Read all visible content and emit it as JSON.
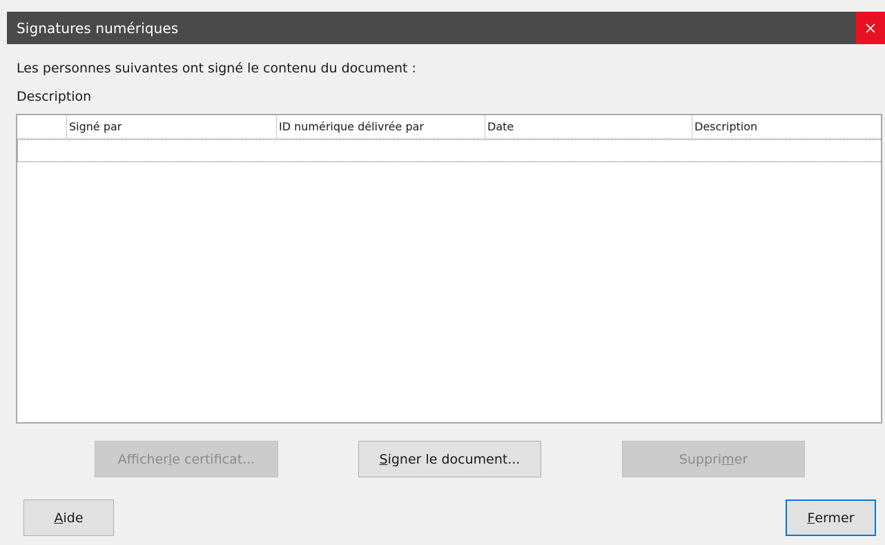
{
  "window": {
    "title": "Signatures numériques",
    "close_icon": "close-icon"
  },
  "intro": "Les personnes suivantes ont signé le contenu du document :",
  "description_label": "Description",
  "table": {
    "columns": [
      "",
      "Signé par",
      "ID numérique délivrée par",
      "Date",
      "Description"
    ],
    "rows": []
  },
  "buttons": {
    "view_certificate": {
      "pre": "Afficher ",
      "mnemonic": "l",
      "post": "e certificat...",
      "enabled": false
    },
    "sign_document": {
      "pre": "",
      "mnemonic": "S",
      "post": "igner le document...",
      "enabled": true
    },
    "remove": {
      "pre": "Suppri",
      "mnemonic": "m",
      "post": "er",
      "enabled": false
    },
    "help": {
      "pre": "",
      "mnemonic": "A",
      "post": "ide",
      "enabled": true
    },
    "close": {
      "pre": "",
      "mnemonic": "F",
      "post": "ermer",
      "enabled": true,
      "default": true
    }
  },
  "colors": {
    "titlebar": "#4a4a4a",
    "close_button": "#e81123",
    "dialog_background": "#f0f0f0",
    "default_button_border": "#0078d7"
  }
}
